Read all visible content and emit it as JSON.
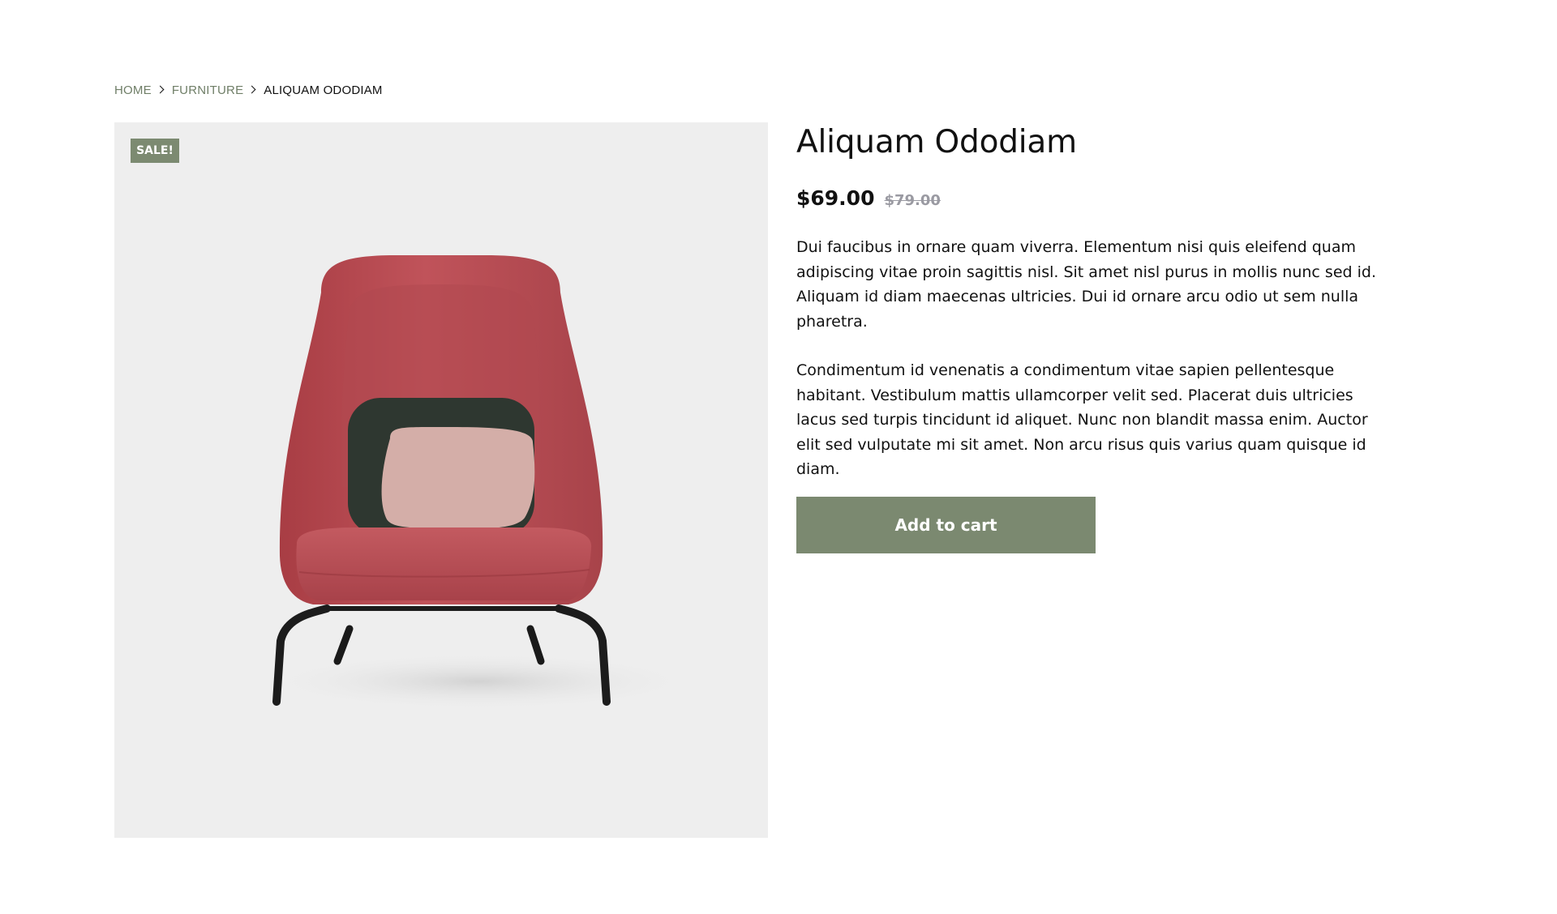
{
  "breadcrumb": {
    "home": "HOME",
    "category": "FURNITURE",
    "current": "ALIQUAM ODODIAM"
  },
  "product": {
    "badge": "SALE!",
    "title": "Aliquam Ododiam",
    "price": "$69.00",
    "old_price": "$79.00",
    "description": [
      "Dui faucibus in ornare quam viverra. Elementum nisi quis eleifend quam adipiscing vitae proin sagittis nisl. Sit amet nisl purus in mollis nunc sed id. Aliquam id diam maecenas ultricies. Dui id ornare arcu odio ut sem nulla pharetra.",
      "Condimentum id venenatis a condimentum vitae sapien pellentesque habitant. Vestibulum mattis ullamcorper velit sed. Placerat duis ultricies lacus sed turpis tincidunt id aliquet. Nunc non blandit massa enim. Auctor elit sed vulputate mi sit amet. Non arcu risus quis varius quam quisque id diam."
    ],
    "add_to_cart": "Add to cart"
  },
  "colors": {
    "accent": "#7b8970",
    "breadcrumb_link": "#6f7e67",
    "old_price": "#9a9aa2",
    "gallery_bg": "#eeeeee",
    "chair": "#b9494f",
    "back_cushion": "#2e3730",
    "front_cushion": "#d4aea8"
  }
}
